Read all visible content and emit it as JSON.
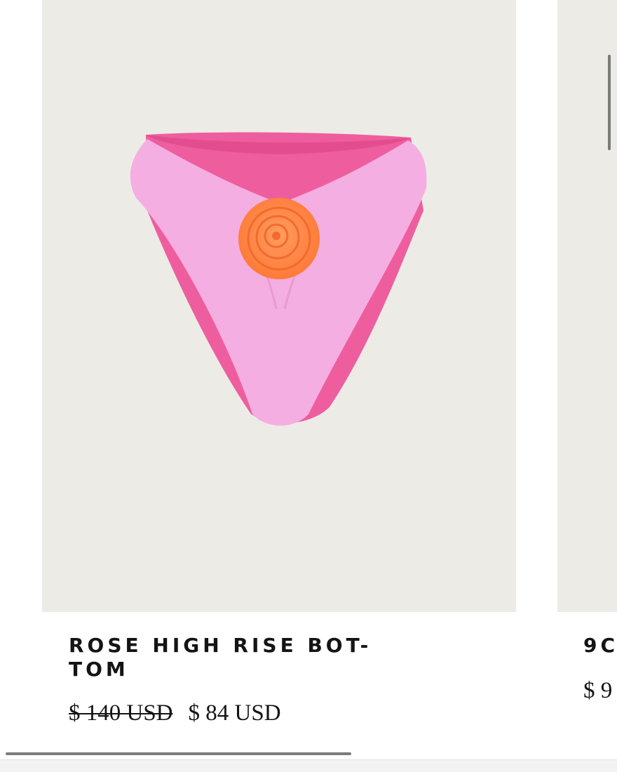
{
  "products": [
    {
      "title": "ROSE HIGH RISE BOT-\nTOM",
      "compare_price": "$ 140 USD",
      "sale_price": "$ 84 USD",
      "image": {
        "subject": "product-photo",
        "colors": {
          "background": "#edebe6",
          "fabric_light": "#f5aee2",
          "fabric_dark": "#ee5e9e",
          "rosette": "#ff8a4c"
        }
      }
    },
    {
      "title": "9C",
      "price": "$ 9"
    }
  ],
  "scrollbar": {
    "horizontal_progress": 0.56
  }
}
